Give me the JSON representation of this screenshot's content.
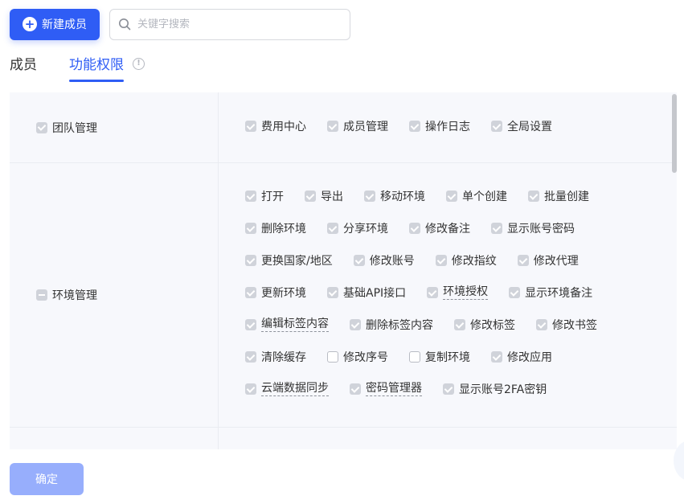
{
  "toolbar": {
    "new_member_label": "新建成员",
    "search_placeholder": "关键字搜索"
  },
  "tabs": [
    {
      "label": "成员",
      "active": false
    },
    {
      "label": "功能权限",
      "active": true
    }
  ],
  "groups": [
    {
      "label": "团队管理",
      "state": "checked",
      "rows": [
        [
          {
            "label": "费用中心",
            "checked": true
          },
          {
            "label": "成员管理",
            "checked": true
          },
          {
            "label": "操作日志",
            "checked": true
          },
          {
            "label": "全局设置",
            "checked": true
          }
        ]
      ]
    },
    {
      "label": "环境管理",
      "state": "indeterminate",
      "rows": [
        [
          {
            "label": "打开",
            "checked": true
          },
          {
            "label": "导出",
            "checked": true
          },
          {
            "label": "移动环境",
            "checked": true
          },
          {
            "label": "单个创建",
            "checked": true
          },
          {
            "label": "批量创建",
            "checked": true
          }
        ],
        [
          {
            "label": "删除环境",
            "checked": true
          },
          {
            "label": "分享环境",
            "checked": true
          },
          {
            "label": "修改备注",
            "checked": true
          },
          {
            "label": "显示账号密码",
            "checked": true
          }
        ],
        [
          {
            "label": "更换国家/地区",
            "checked": true
          },
          {
            "label": "修改账号",
            "checked": true
          },
          {
            "label": "修改指纹",
            "checked": true
          },
          {
            "label": "修改代理",
            "checked": true
          }
        ],
        [
          {
            "label": "更新环境",
            "checked": true
          },
          {
            "label": "基础API接口",
            "checked": true
          },
          {
            "label": "环境授权",
            "checked": true,
            "dashed": true
          },
          {
            "label": "显示环境备注",
            "checked": true
          }
        ],
        [
          {
            "label": "编辑标签内容",
            "checked": true,
            "dashed": true
          },
          {
            "label": "删除标签内容",
            "checked": true
          },
          {
            "label": "修改标签",
            "checked": true
          },
          {
            "label": "修改书签",
            "checked": true
          }
        ],
        [
          {
            "label": "清除缓存",
            "checked": true
          },
          {
            "label": "修改序号",
            "checked": false
          },
          {
            "label": "复制环境",
            "checked": false
          },
          {
            "label": "修改应用",
            "checked": true
          }
        ],
        [
          {
            "label": "云端数据同步",
            "checked": true,
            "dashed": true
          },
          {
            "label": "密码管理器",
            "checked": true,
            "dashed": true
          },
          {
            "label": "显示账号2FA密钥",
            "checked": true
          }
        ]
      ]
    }
  ],
  "footer": {
    "confirm_label": "确定"
  },
  "colors": {
    "primary": "#2f5df5",
    "disabled_primary": "#97aefc",
    "panel_bg": "#f7f8fc"
  }
}
